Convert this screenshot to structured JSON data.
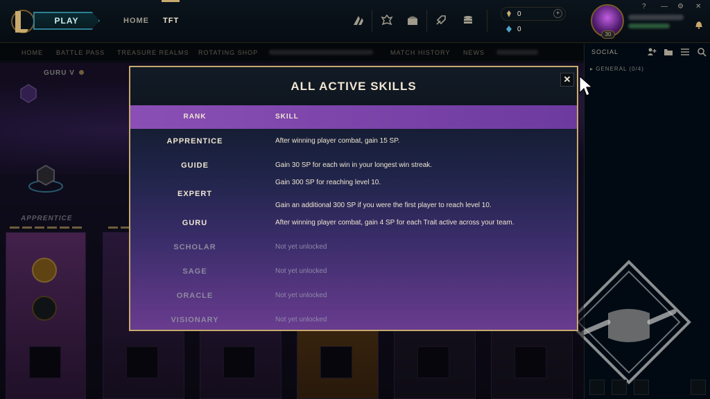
{
  "topbar": {
    "play_label": "PLAY",
    "nav": [
      {
        "label": "HOME",
        "active": false
      },
      {
        "label": "TFT",
        "active": true
      }
    ],
    "icons": [
      "tft-arrows-icon",
      "pass-icon",
      "chest-icon",
      "rocket-icon",
      "collection-icon"
    ],
    "currency": {
      "rp": "0",
      "be": "0"
    },
    "level": "30",
    "window_controls": [
      "?",
      "—",
      "⚙",
      "✕"
    ]
  },
  "subnav": {
    "items": [
      "HOME",
      "BATTLE PASS",
      "TREASURE REALMS",
      "ROTATING SHOP",
      "MATCH HISTORY",
      "NEWS"
    ]
  },
  "background": {
    "rank_label": "GURU V",
    "apprentice_label": "APPRENTICE"
  },
  "social": {
    "title": "SOCIAL",
    "group": "GENERAL (0/4)"
  },
  "modal": {
    "title": "ALL ACTIVE SKILLS",
    "close_label": "✕",
    "header": {
      "rank": "RANK",
      "skill": "SKILL"
    },
    "rows": [
      {
        "rank": "APPRENTICE",
        "skills": [
          "After winning player combat, gain 15 SP."
        ],
        "unlocked": true
      },
      {
        "rank": "GUIDE",
        "skills": [
          "Gain 30 SP for each win in your longest win streak."
        ],
        "unlocked": true
      },
      {
        "rank": "EXPERT",
        "skills": [
          "Gain 300 SP for reaching level 10.",
          "Gain an additional 300 SP if you were the first player to reach level 10."
        ],
        "unlocked": true
      },
      {
        "rank": "GURU",
        "skills": [
          "After winning player combat, gain 4 SP for each Trait active across your team."
        ],
        "unlocked": true
      },
      {
        "rank": "SCHOLAR",
        "skills": [
          "Not yet unlocked"
        ],
        "unlocked": false
      },
      {
        "rank": "SAGE",
        "skills": [
          "Not yet unlocked"
        ],
        "unlocked": false
      },
      {
        "rank": "ORACLE",
        "skills": [
          "Not yet unlocked"
        ],
        "unlocked": false
      },
      {
        "rank": "VISIONARY",
        "skills": [
          "Not yet unlocked"
        ],
        "unlocked": false
      }
    ]
  },
  "colors": {
    "gold": "#c8aa6e",
    "header_purple": "#8a4fb4",
    "text_light": "#f0e6d2"
  }
}
